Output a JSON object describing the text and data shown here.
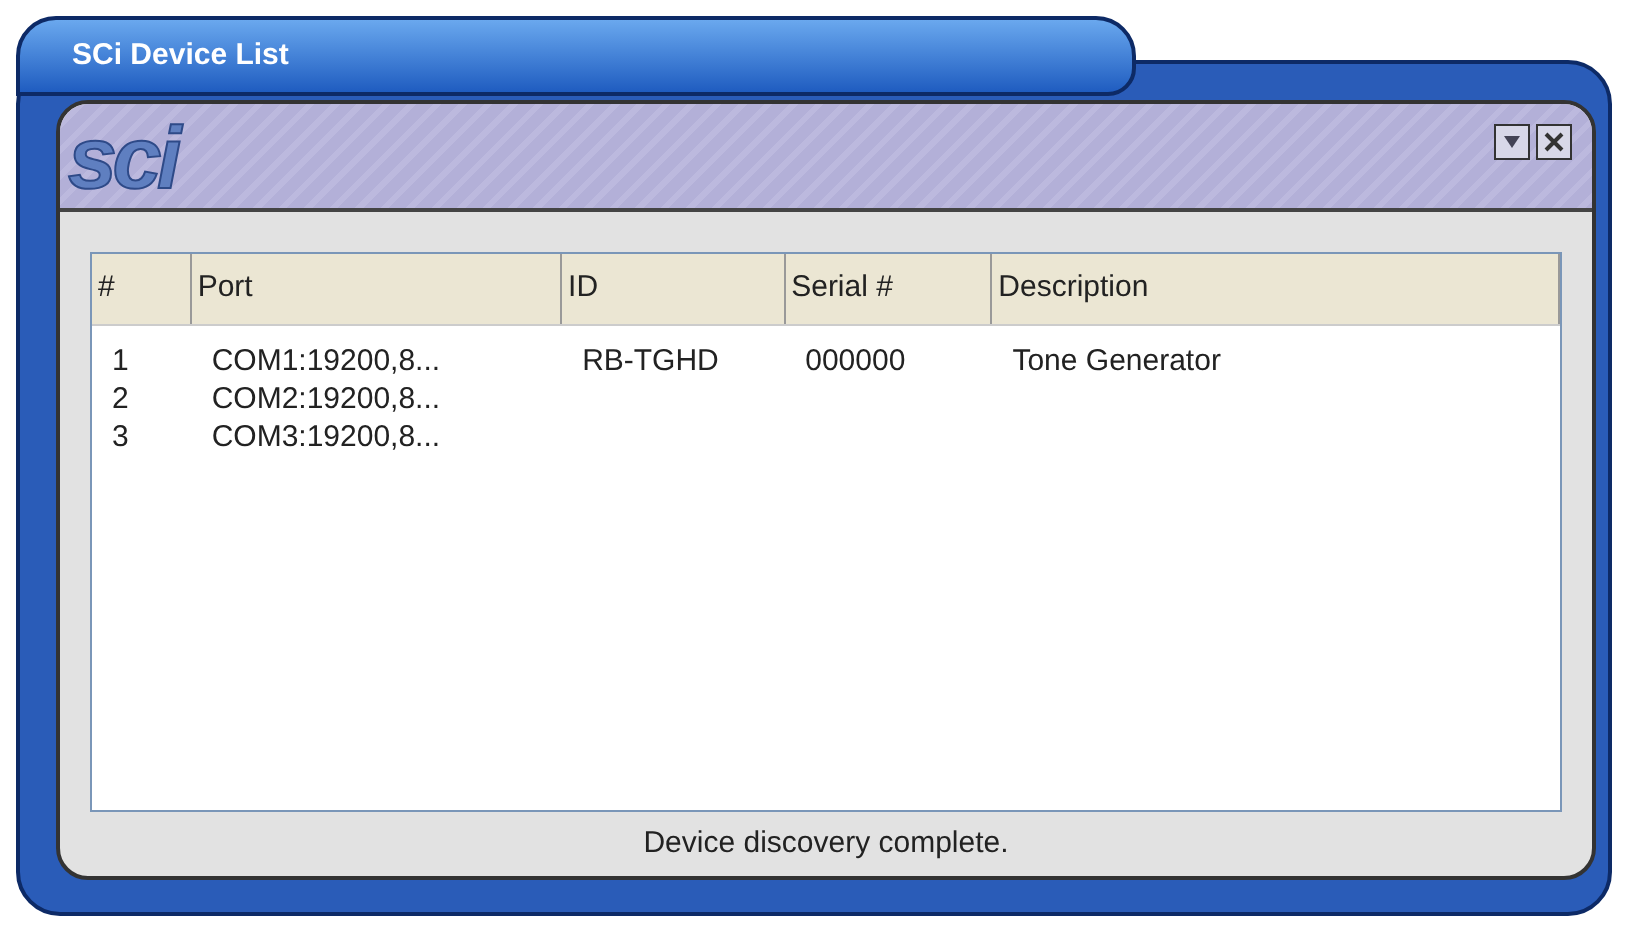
{
  "window": {
    "title": "SCi Device List",
    "logo": "sci"
  },
  "table": {
    "columns": [
      "#",
      "Port",
      "ID",
      "Serial #",
      "Description"
    ],
    "rows": [
      {
        "cells": [
          "1",
          "COM1:19200,8...",
          "RB-TGHD",
          "000000",
          "Tone Generator"
        ]
      },
      {
        "cells": [
          "2",
          "COM2:19200,8...",
          "",
          "",
          ""
        ]
      },
      {
        "cells": [
          "3",
          "COM3:19200,8...",
          "",
          "",
          ""
        ]
      }
    ]
  },
  "status_bar": "Device discovery complete."
}
